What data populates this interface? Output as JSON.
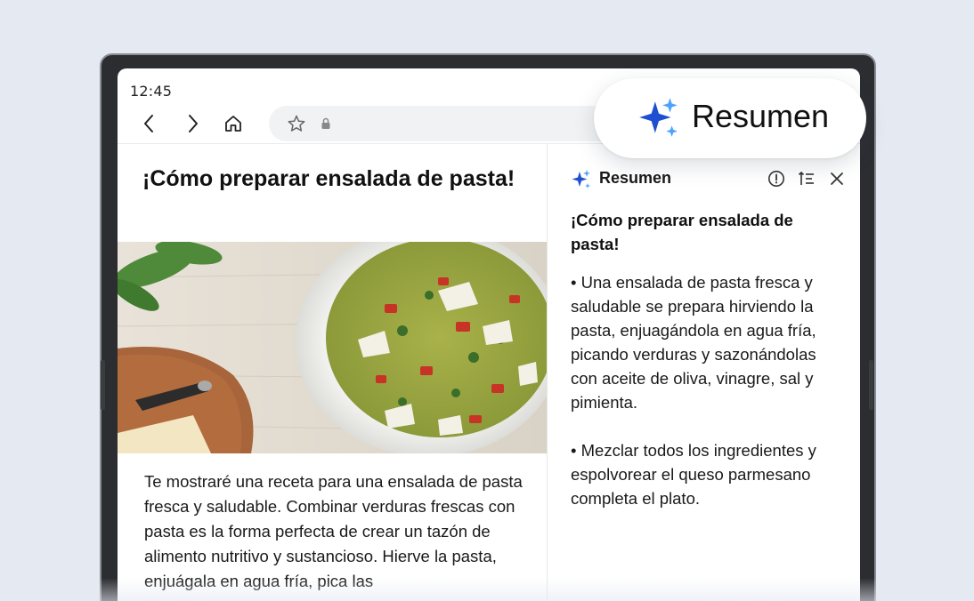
{
  "status_bar": {
    "time": "12:45"
  },
  "article": {
    "title": "¡Cómo preparar ensalada de pasta!",
    "body": "Te mostraré una receta para una ensalada de pasta fresca y saludable. Combinar verduras frescas con pasta es la forma perfecta de crear un tazón de alimento nutritivo y sustancioso. Hierve la pasta, enjuágala en agua fría, pica las"
  },
  "summary_panel": {
    "title": "Resumen",
    "heading": "¡Cómo preparar ensalada de pasta!",
    "bullets": [
      "• Una ensalada de pasta fresca y saludable se prepara hirviendo la pasta, enjuagándola en agua fría, picando verduras y sazonándolas con aceite de oliva, vinagre, sal y pimienta.",
      "• Mezclar todos los ingredientes y espolvorear el queso parmesano completa el plato."
    ]
  },
  "pill": {
    "label": "Resumen"
  },
  "colors": {
    "background": "#e5e9f2",
    "sparkle_dark": "#1f4fd1",
    "sparkle_light": "#4aa3ff"
  },
  "icons": {
    "back": "chevron-left-icon",
    "forward": "chevron-right-icon",
    "home": "home-icon",
    "bookmark": "star-icon",
    "secure": "lock-icon",
    "ai": "sparkle-icon",
    "info": "info-icon",
    "format": "list-format-icon",
    "close": "close-icon"
  }
}
